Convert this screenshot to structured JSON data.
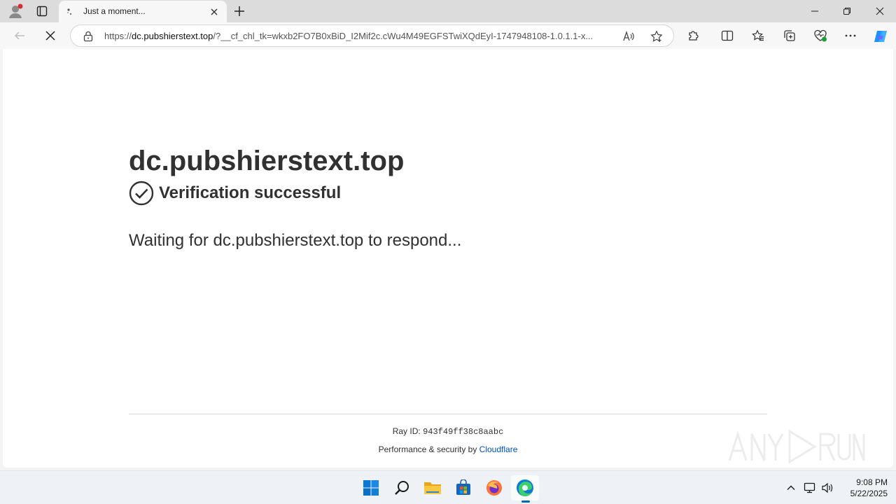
{
  "tab": {
    "title": "Just a moment..."
  },
  "address": {
    "url_prefix": "https://",
    "url_host": "dc.pubshierstext.top",
    "url_rest": "/?__cf_chl_tk=wkxb2FO7B0xBiD_I2Mif2c.cWu4M49EGFSTwiXQdEyI-1747948108-1.0.1.1-x..."
  },
  "page": {
    "site_title": "dc.pubshierstext.top",
    "verify_text": "Verification successful",
    "waiting_text": "Waiting for dc.pubshierstext.top to respond...",
    "ray_label": "Ray ID: ",
    "ray_id": "943f49ff38c8aabc",
    "perf_label": "Performance & security by ",
    "perf_link": "Cloudflare"
  },
  "taskbar": {
    "time": "9:08 PM",
    "date": "5/22/2025"
  },
  "colors": {
    "accent": "#0067c0",
    "link": "#0051c3",
    "text": "#313131"
  },
  "icons": [
    "profile-icon",
    "tab-actions-icon",
    "loading-icon",
    "close-icon",
    "plus-icon",
    "minimize-icon",
    "restore-icon",
    "back-arrow-icon",
    "stop-icon",
    "lock-icon",
    "read-aloud-icon",
    "star-icon",
    "puzzle-icon",
    "split-screen-icon",
    "favorites-icon",
    "collections-icon",
    "heart-pulse-icon",
    "ellipsis-icon",
    "copilot-icon",
    "check-circle-icon",
    "windows-start-icon",
    "search-icon",
    "folder-icon",
    "store-icon",
    "firefox-icon",
    "edge-icon",
    "chevron-up-icon",
    "network-icon",
    "volume-icon"
  ]
}
